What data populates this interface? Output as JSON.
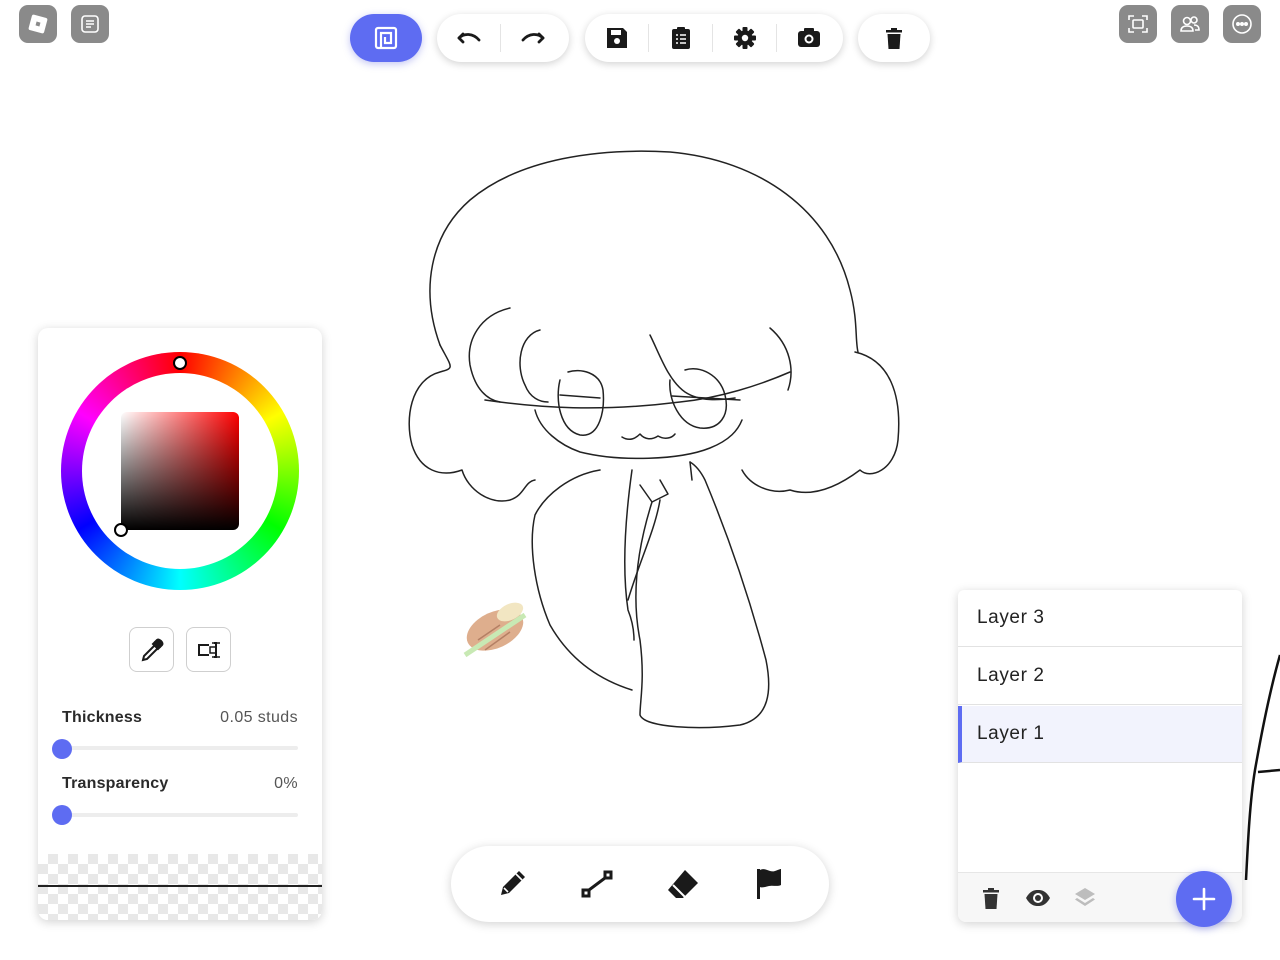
{
  "colors": {
    "accent": "#5e6cf2",
    "icon_dark": "#1a1a1a",
    "corner_gray": "#8a8a8a"
  },
  "corner_left": [
    {
      "icon": "roblox-logo-icon"
    },
    {
      "icon": "chat-icon"
    }
  ],
  "corner_right": [
    {
      "icon": "screen-capture-icon"
    },
    {
      "icon": "friends-icon"
    },
    {
      "icon": "more-icon"
    }
  ],
  "toolbar": {
    "groups": [
      [
        {
          "icon": "canvas-mode-icon",
          "active": true
        }
      ],
      [
        {
          "icon": "undo-icon"
        },
        {
          "icon": "redo-icon"
        }
      ],
      [
        {
          "icon": "save-icon"
        },
        {
          "icon": "clipboard-list-icon"
        },
        {
          "icon": "gear-icon"
        },
        {
          "icon": "camera-icon"
        }
      ],
      [
        {
          "icon": "trash-icon"
        }
      ]
    ]
  },
  "color_panel": {
    "hue_deg": 0,
    "saturation": 0,
    "value": 0,
    "tools": [
      {
        "icon": "eyedropper-icon"
      },
      {
        "icon": "text-cursor-icon"
      }
    ],
    "thickness_label": "Thickness",
    "thickness_value": "0.05 studs",
    "thickness_fraction": 0.0,
    "transparency_label": "Transparency",
    "transparency_value": "0%",
    "transparency_fraction": 0.0
  },
  "bottom_tools": [
    {
      "icon": "pencil-icon"
    },
    {
      "icon": "line-tool-icon"
    },
    {
      "icon": "eraser-icon"
    },
    {
      "icon": "flag-icon"
    }
  ],
  "layers": {
    "items": [
      {
        "label": "Layer 3",
        "active": false
      },
      {
        "label": "Layer 2",
        "active": false
      },
      {
        "label": "Layer 1",
        "active": true
      }
    ],
    "footer": [
      {
        "icon": "trash-icon"
      },
      {
        "icon": "eye-icon"
      },
      {
        "icon": "layers-icon"
      }
    ],
    "add_icon": "plus-icon"
  }
}
